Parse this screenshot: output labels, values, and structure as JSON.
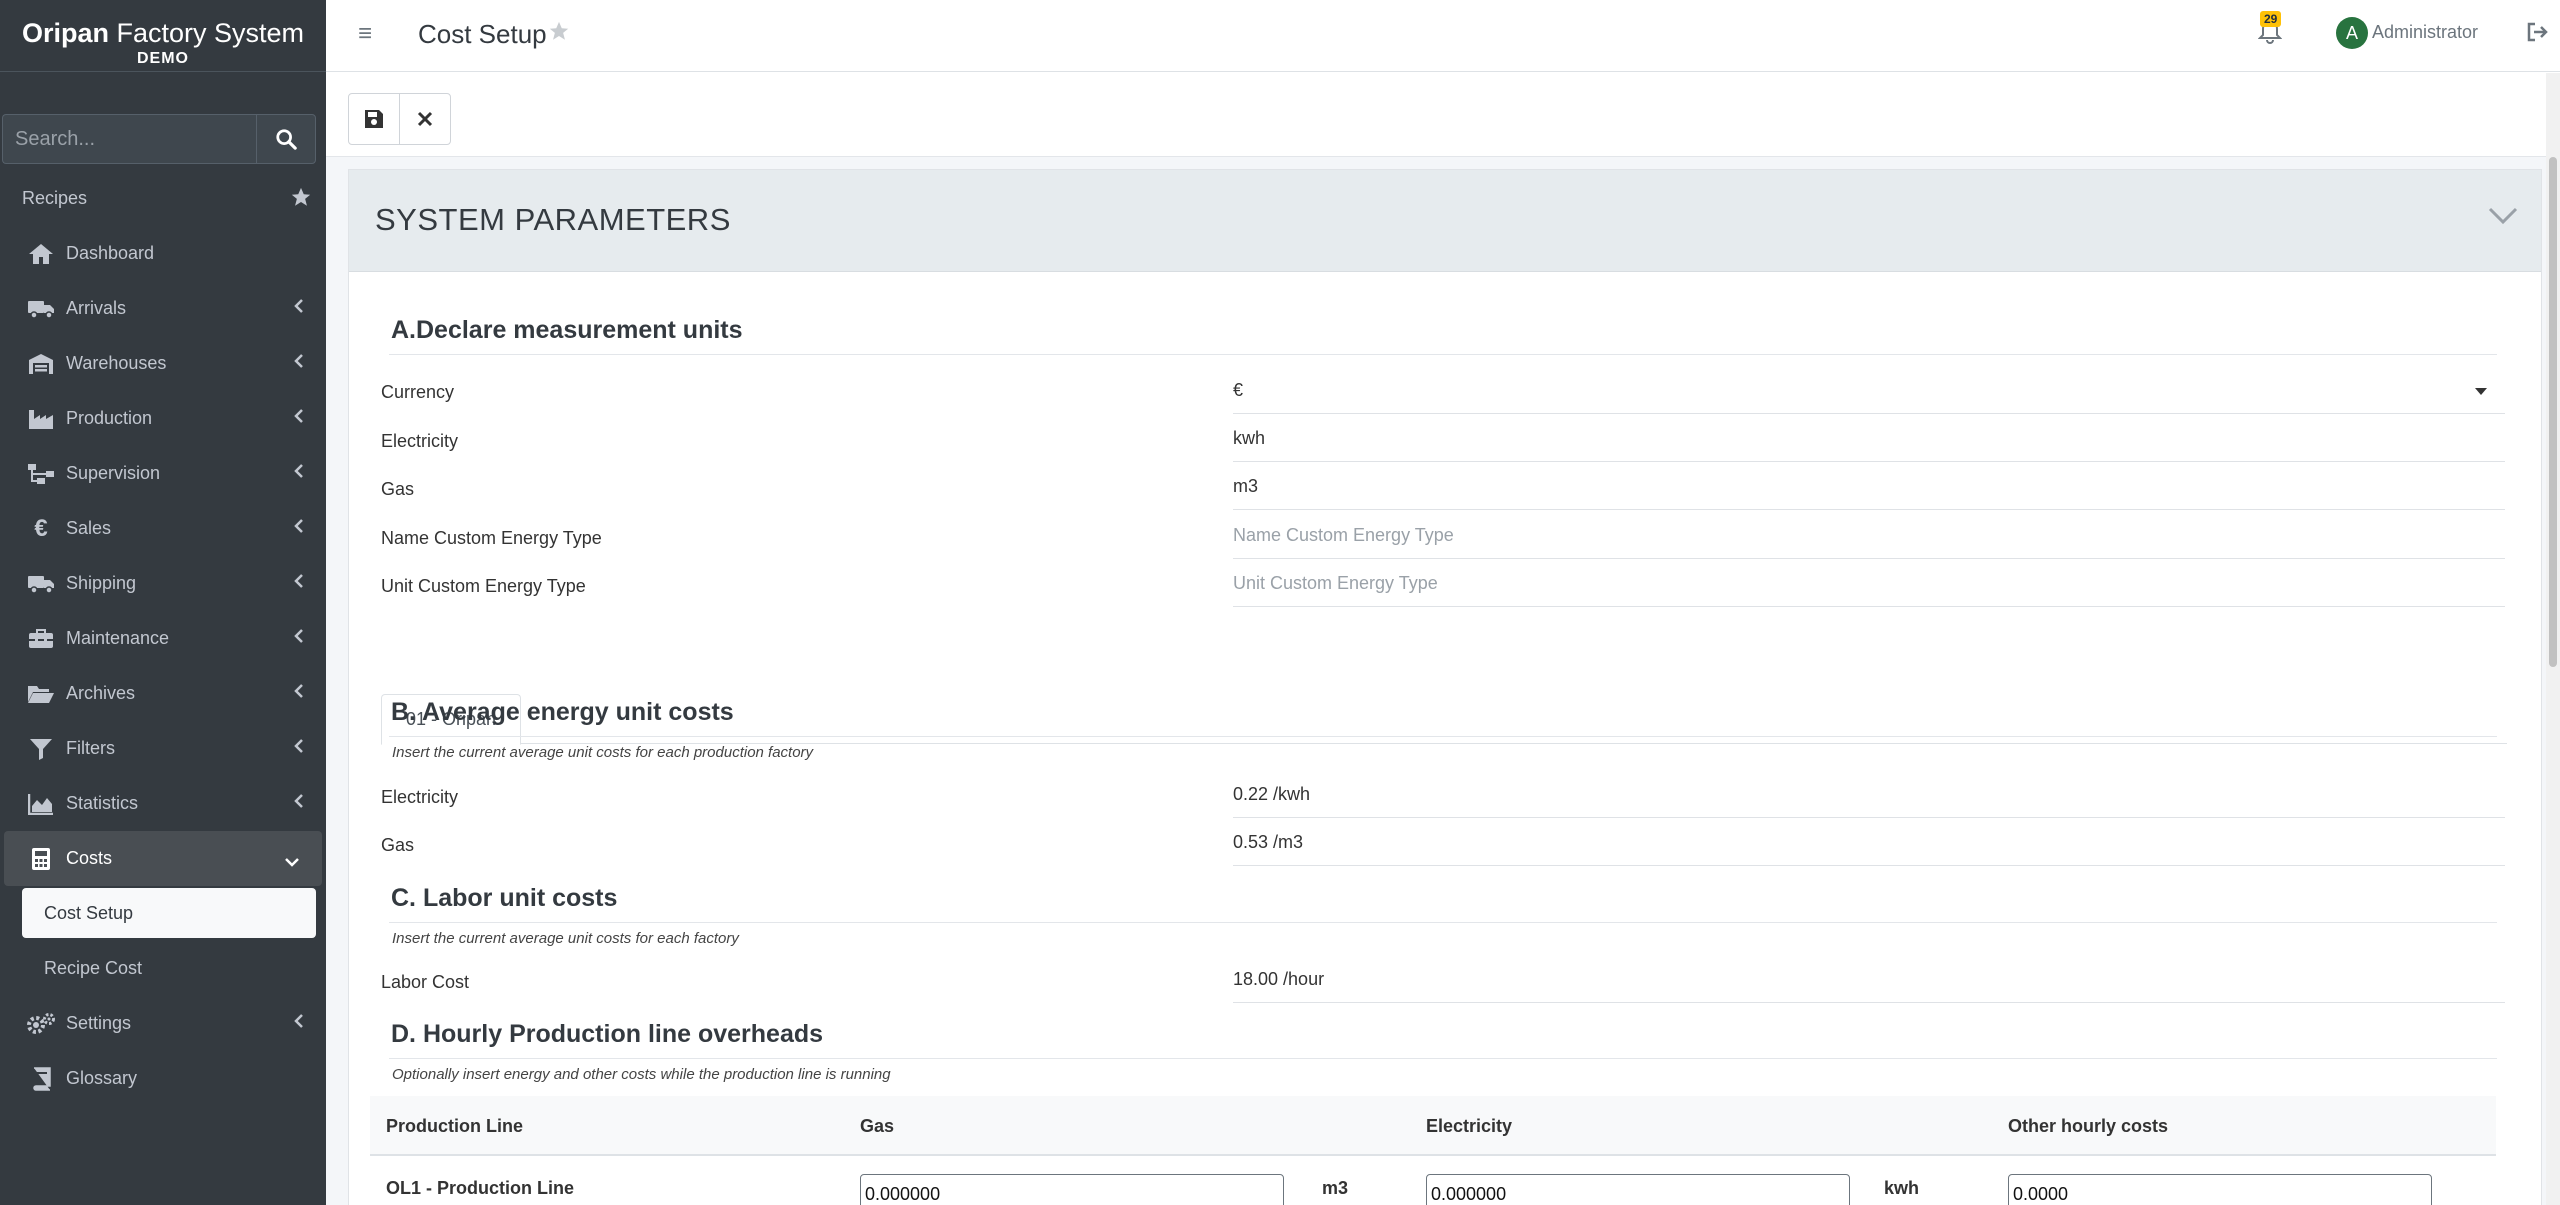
{
  "sidebar": {
    "brand_name_bold": "Oripan",
    "brand_name_rest": " Factory System",
    "brand_sub": "DEMO",
    "search_placeholder": "Search...",
    "recipes_label": "Recipes",
    "items": [
      {
        "label": "Dashboard",
        "icon": "home-icon"
      },
      {
        "label": "Arrivals",
        "icon": "truck-icon"
      },
      {
        "label": "Warehouses",
        "icon": "warehouse-icon"
      },
      {
        "label": "Production",
        "icon": "industry-icon"
      },
      {
        "label": "Supervision",
        "icon": "sitemap-icon"
      },
      {
        "label": "Sales",
        "icon": "euro-icon"
      },
      {
        "label": "Shipping",
        "icon": "truck-icon"
      },
      {
        "label": "Maintenance",
        "icon": "toolbox-icon"
      },
      {
        "label": "Archives",
        "icon": "folder-open-icon"
      },
      {
        "label": "Filters",
        "icon": "filter-icon"
      },
      {
        "label": "Statistics",
        "icon": "chart-area-icon"
      },
      {
        "label": "Costs",
        "icon": "calculator-icon"
      },
      {
        "label": "Settings",
        "icon": "cogs-icon"
      },
      {
        "label": "Glossary",
        "icon": "book-icon"
      }
    ],
    "costs_sub": [
      {
        "label": "Cost Setup"
      },
      {
        "label": "Recipe Cost"
      }
    ]
  },
  "topbar": {
    "page_title": "Cost Setup",
    "notification_count": "29",
    "avatar_initial": "A",
    "user_name": "Administrator"
  },
  "card": {
    "title": "SYSTEM PARAMETERS",
    "section_a": {
      "heading": "A.Declare measurement units",
      "rows": [
        {
          "label": "Currency",
          "value": "€"
        },
        {
          "label": "Electricity",
          "value": "kwh"
        },
        {
          "label": "Gas",
          "value": "m3"
        },
        {
          "label": "Name Custom Energy Type",
          "placeholder": "Name Custom Energy Type"
        },
        {
          "label": "Unit Custom Energy Type",
          "placeholder": "Unit Custom Energy Type"
        }
      ]
    },
    "tab_label": "01 - Oripan",
    "section_b": {
      "heading": "B. Average energy unit costs",
      "hint": "Insert the current average unit costs for each production factory",
      "rows": [
        {
          "label": "Electricity",
          "value": "0.22 /kwh"
        },
        {
          "label": "Gas",
          "value": "0.53 /m3"
        }
      ]
    },
    "section_c": {
      "heading": "C. Labor unit costs",
      "hint": "Insert the current average unit costs for each factory",
      "rows": [
        {
          "label": "Labor Cost",
          "value": "18.00 /hour"
        }
      ]
    },
    "section_d": {
      "heading": "D. Hourly Production line overheads",
      "hint": "Optionally insert energy and other costs while the production line is running",
      "columns": [
        "Production Line",
        "Gas",
        "Electricity",
        "Other hourly costs"
      ],
      "rows": [
        {
          "name": "OL1 - Production Line",
          "gas": "0.000000",
          "gas_unit": "m3",
          "electricity": "0.000000",
          "electricity_unit": "kwh",
          "other": "0.0000"
        }
      ]
    }
  },
  "colors": {
    "sidebar_bg": "#343a40",
    "header_bg": "#e6ebee",
    "badge": "#ffc107",
    "avatar": "#28733f"
  }
}
